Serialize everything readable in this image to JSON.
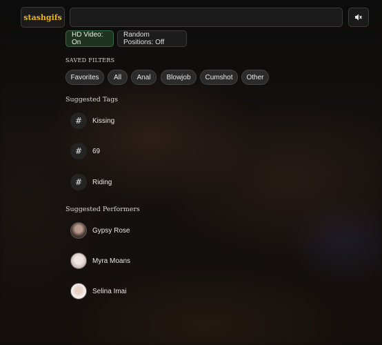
{
  "header": {
    "logo_text": "stashgifs",
    "search_value": "",
    "mute_icon": "speaker-muted-icon"
  },
  "toggles": {
    "hd_video": "HD Video: On",
    "random_positions": "Random Positions: Off"
  },
  "saved_filters": {
    "label": "SAVED FILTERS",
    "items": [
      "Favorites",
      "All",
      "Anal",
      "Blowjob",
      "Cumshot",
      "Other"
    ]
  },
  "suggested_tags": {
    "label": "Suggested Tags",
    "icon": "hash-icon",
    "items": [
      "Kissing",
      "69",
      "Riding"
    ]
  },
  "suggested_performers": {
    "label": "Suggested Performers",
    "items": [
      "Gypsy Rose",
      "Myra Moans",
      "Selina Imai"
    ]
  },
  "colors": {
    "logo": "#e8b923",
    "hd_active_bg": "#1f3321",
    "hd_active_border": "#3d6a41"
  }
}
